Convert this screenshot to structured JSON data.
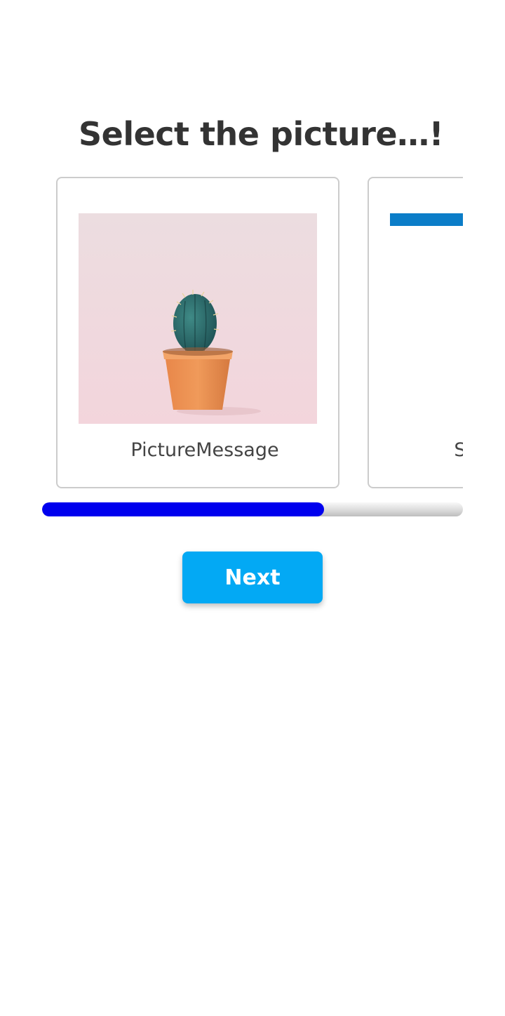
{
  "title": "Select the picture…!",
  "cards": [
    {
      "caption": "PictureMessage",
      "image": "cactus-in-orange-pot"
    },
    {
      "caption": "S",
      "image": "blue-bar"
    }
  ],
  "progress": {
    "value": 0.67
  },
  "next_button": {
    "label": "Next"
  },
  "colors": {
    "title_text": "#333333",
    "card_border": "#cccccc",
    "progress_fill": "#0000ee",
    "button_bg": "#03a9f4",
    "button_text": "#ffffff",
    "card2_bar": "#0b7dc8",
    "image_bg": "#f0dde1",
    "pot": "#e89451",
    "cactus": "#2a6b66"
  }
}
